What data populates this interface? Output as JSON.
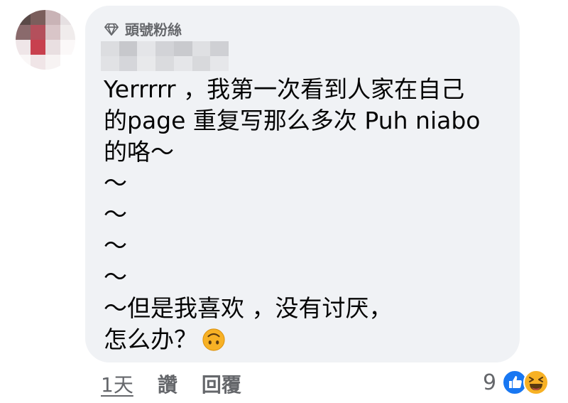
{
  "badge": {
    "label": "頭號粉絲",
    "icon": "diamond-icon"
  },
  "comment": {
    "lines": [
      "Yerrrrr ，我第一次看到人家在自己",
      "的page 重复写那么多次 Puh niabo",
      "的咯～",
      "～",
      "～",
      "～",
      "～",
      "～但是我喜欢 ，没有讨厌，",
      "怎么办？"
    ],
    "trailing_emoji": "upside-down-face-icon"
  },
  "actions": {
    "time": "1天",
    "like": "讚",
    "reply": "回覆"
  },
  "reactions": {
    "count": "9",
    "icons": [
      "like-reaction-icon",
      "haha-reaction-icon"
    ]
  },
  "colors": {
    "bubble": "#f0f2f5",
    "secondary_text": "#65676b",
    "like_blue": "#1877f2",
    "haha_yellow": "#f7b125"
  }
}
